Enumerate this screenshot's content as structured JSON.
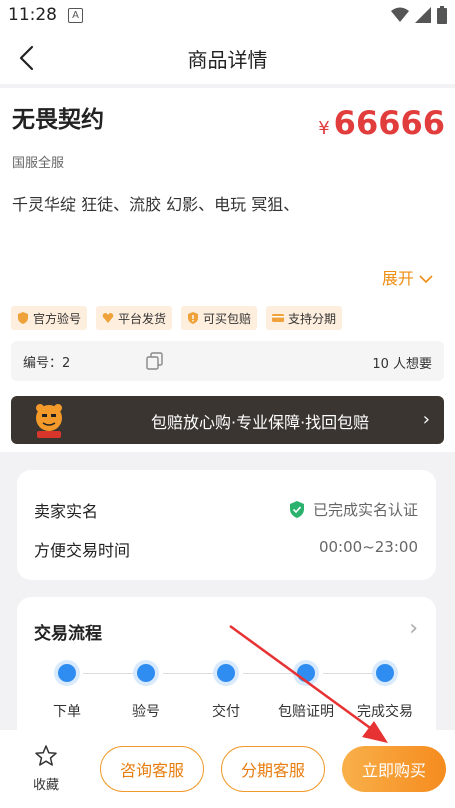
{
  "status_bar": {
    "time": "11:28",
    "badge": "A"
  },
  "nav": {
    "title": "商品详情"
  },
  "product": {
    "title": "无畏契约",
    "price_symbol": "¥",
    "price": "66666",
    "server": "国服全服",
    "description": "千灵华绽 狂徒、流胶 幻影、电玩 冥狙、",
    "expand_label": "展开",
    "tags": [
      "官方验号",
      "平台发货",
      "可买包赔",
      "支持分期"
    ],
    "code_label": "编号：2",
    "want_label": "10 人想要"
  },
  "banner": {
    "text": "包赔放心购·专业保障·找回包赔"
  },
  "seller": {
    "realname_label": "卖家实名",
    "realname_value": "已完成实名认证",
    "time_label": "方便交易时间",
    "time_value": "00:00~23:00"
  },
  "flow": {
    "title": "交易流程",
    "steps": [
      "下单",
      "验号",
      "交付",
      "包赔证明",
      "完成交易"
    ]
  },
  "bottom": {
    "fav_label": "收藏",
    "consult_label": "咨询客服",
    "installment_label": "分期客服",
    "buy_label": "立即购买"
  },
  "colors": {
    "accent": "#f58b1e",
    "price": "#e23d3d",
    "step": "#2f8df2",
    "verified": "#2bb36e"
  }
}
